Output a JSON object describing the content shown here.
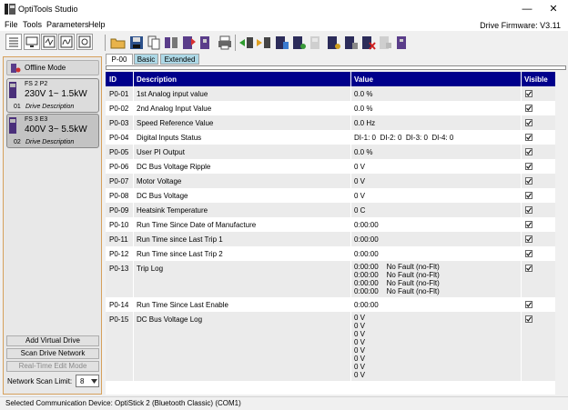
{
  "window": {
    "title": "OptiTools Studio",
    "minimize": "—",
    "maximize": "☐",
    "close": "✕"
  },
  "menu": {
    "items": [
      "File",
      "Tools",
      "Parameters",
      "Help"
    ],
    "firmware": "Drive Firmware: V3.11"
  },
  "left": {
    "offline_mode": "Offline Mode",
    "drives": [
      {
        "frame": "FS 2  P2",
        "rating": "230V 1~  1.5kW",
        "num": "01",
        "desc": "Drive Description"
      },
      {
        "frame": "FS 3  E3",
        "rating": "400V 3~  5.5kW",
        "num": "02",
        "desc": "Drive Description"
      }
    ],
    "add_virtual": "Add Virtual Drive",
    "scan_network": "Scan Drive Network",
    "realtime_edit": "Real-Time Edit Mode",
    "scan_limit_label": "Network Scan Limit:",
    "scan_limit_value": "8"
  },
  "tabs": [
    "P-00",
    "Basic",
    "Extended"
  ],
  "grid": {
    "headers": {
      "id": "ID",
      "desc": "Description",
      "value": "Value",
      "visible": "Visible"
    },
    "rows": [
      {
        "id": "P0-01",
        "desc": "1st Analog input value",
        "value": [
          "0.0 %"
        ],
        "visible": true
      },
      {
        "id": "P0-02",
        "desc": "2nd Analog Input Value",
        "value": [
          "0.0 %"
        ],
        "visible": true
      },
      {
        "id": "P0-03",
        "desc": "Speed Reference Value",
        "value": [
          "0.0 Hz"
        ],
        "visible": true
      },
      {
        "id": "P0-04",
        "desc": "Digital Inputs Status",
        "value": [
          "DI-1: 0  DI-2: 0  DI-3: 0  DI-4: 0"
        ],
        "visible": true
      },
      {
        "id": "P0-05",
        "desc": "User PI Output",
        "value": [
          "0.0 %"
        ],
        "visible": true
      },
      {
        "id": "P0-06",
        "desc": "DC Bus Voltage Ripple",
        "value": [
          "0 V"
        ],
        "visible": true
      },
      {
        "id": "P0-07",
        "desc": "Motor Voltage",
        "value": [
          "0 V"
        ],
        "visible": true
      },
      {
        "id": "P0-08",
        "desc": "DC Bus Voltage",
        "value": [
          "0 V"
        ],
        "visible": true
      },
      {
        "id": "P0-09",
        "desc": "Heatsink Temperature",
        "value": [
          "0 C"
        ],
        "visible": true
      },
      {
        "id": "P0-10",
        "desc": "Run Time Since Date of Manufacture",
        "value": [
          "0:00:00"
        ],
        "visible": true
      },
      {
        "id": "P0-11",
        "desc": "Run Time since Last Trip 1",
        "value": [
          "0:00:00"
        ],
        "visible": true
      },
      {
        "id": "P0-12",
        "desc": "Run Time since Last Trip 2",
        "value": [
          "0:00:00"
        ],
        "visible": true
      },
      {
        "id": "P0-13",
        "desc": "Trip Log",
        "value": [
          "0:00:00    No Fault (no-Flt)",
          "0:00:00    No Fault (no-Flt)",
          "0:00:00    No Fault (no-Flt)",
          "0:00:00    No Fault (no-Flt)"
        ],
        "visible": true
      },
      {
        "id": "P0-14",
        "desc": "Run Time Since Last Enable",
        "value": [
          "0:00:00"
        ],
        "visible": true
      },
      {
        "id": "P0-15",
        "desc": "DC Bus Voltage Log",
        "value": [
          "0 V",
          "0 V",
          "0 V",
          "0 V",
          "0 V",
          "0 V",
          "0 V",
          "0 V"
        ],
        "visible": true
      }
    ]
  },
  "status": "Selected Communication Device: OptiStick 2 (Bluetooth Classic) (COM1)"
}
